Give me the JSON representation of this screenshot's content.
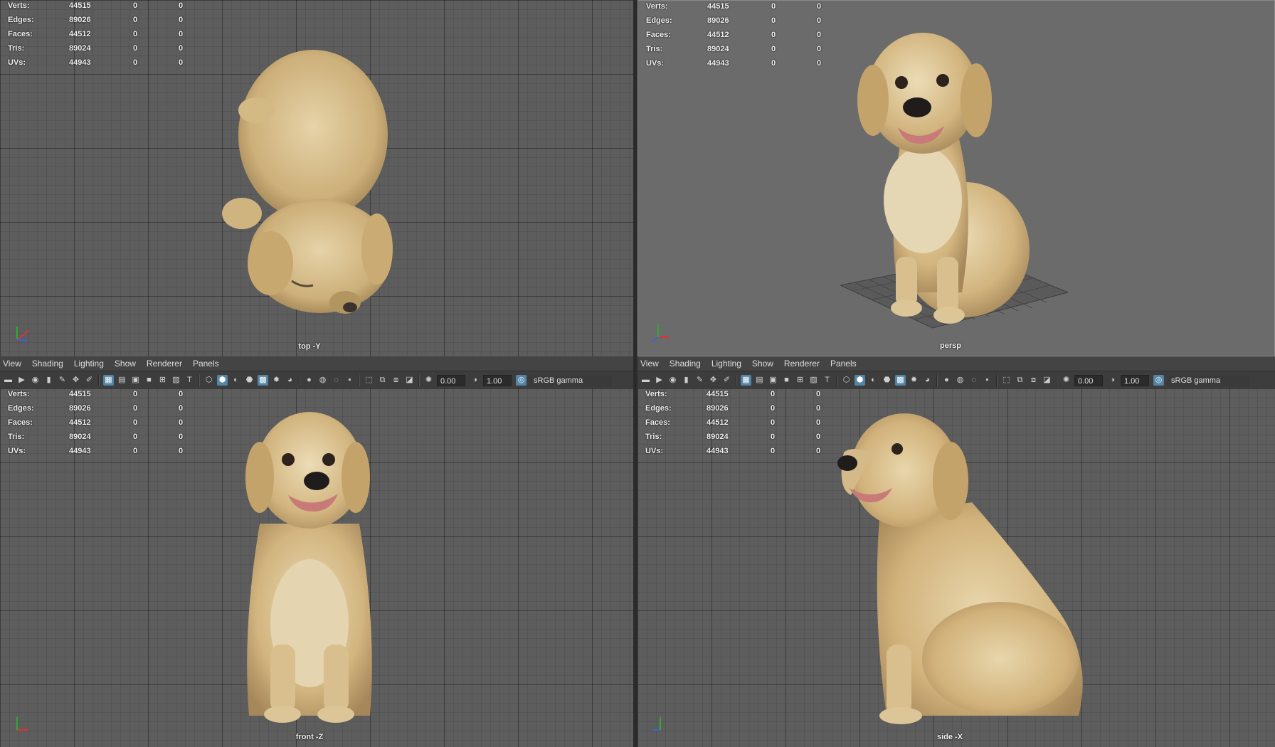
{
  "stats": {
    "rows": [
      {
        "label": "Verts:",
        "count": "44515",
        "v1": "0",
        "v2": "0"
      },
      {
        "label": "Edges:",
        "count": "89026",
        "v1": "0",
        "v2": "0"
      },
      {
        "label": "Faces:",
        "count": "44512",
        "v1": "0",
        "v2": "0"
      },
      {
        "label": "Tris:",
        "count": "89024",
        "v1": "0",
        "v2": "0"
      },
      {
        "label": "UVs:",
        "count": "44943",
        "v1": "0",
        "v2": "0"
      }
    ]
  },
  "viewports": {
    "top": {
      "camera": "top -Y"
    },
    "persp": {
      "camera": "persp"
    },
    "front": {
      "camera": "front -Z"
    },
    "side": {
      "camera": "side -X"
    }
  },
  "panel_menu": [
    "View",
    "Shading",
    "Lighting",
    "Show",
    "Renderer",
    "Panels"
  ],
  "toolbar": {
    "exposure": "0.00",
    "gamma": "1.00",
    "color_space": "sRGB gamma"
  },
  "colors": {
    "viewport_bg": "#5d5d5d",
    "persp_bg": "#6b6b6b",
    "accent_icon": "#5285a6",
    "dog_fur": "#d9c08e"
  }
}
